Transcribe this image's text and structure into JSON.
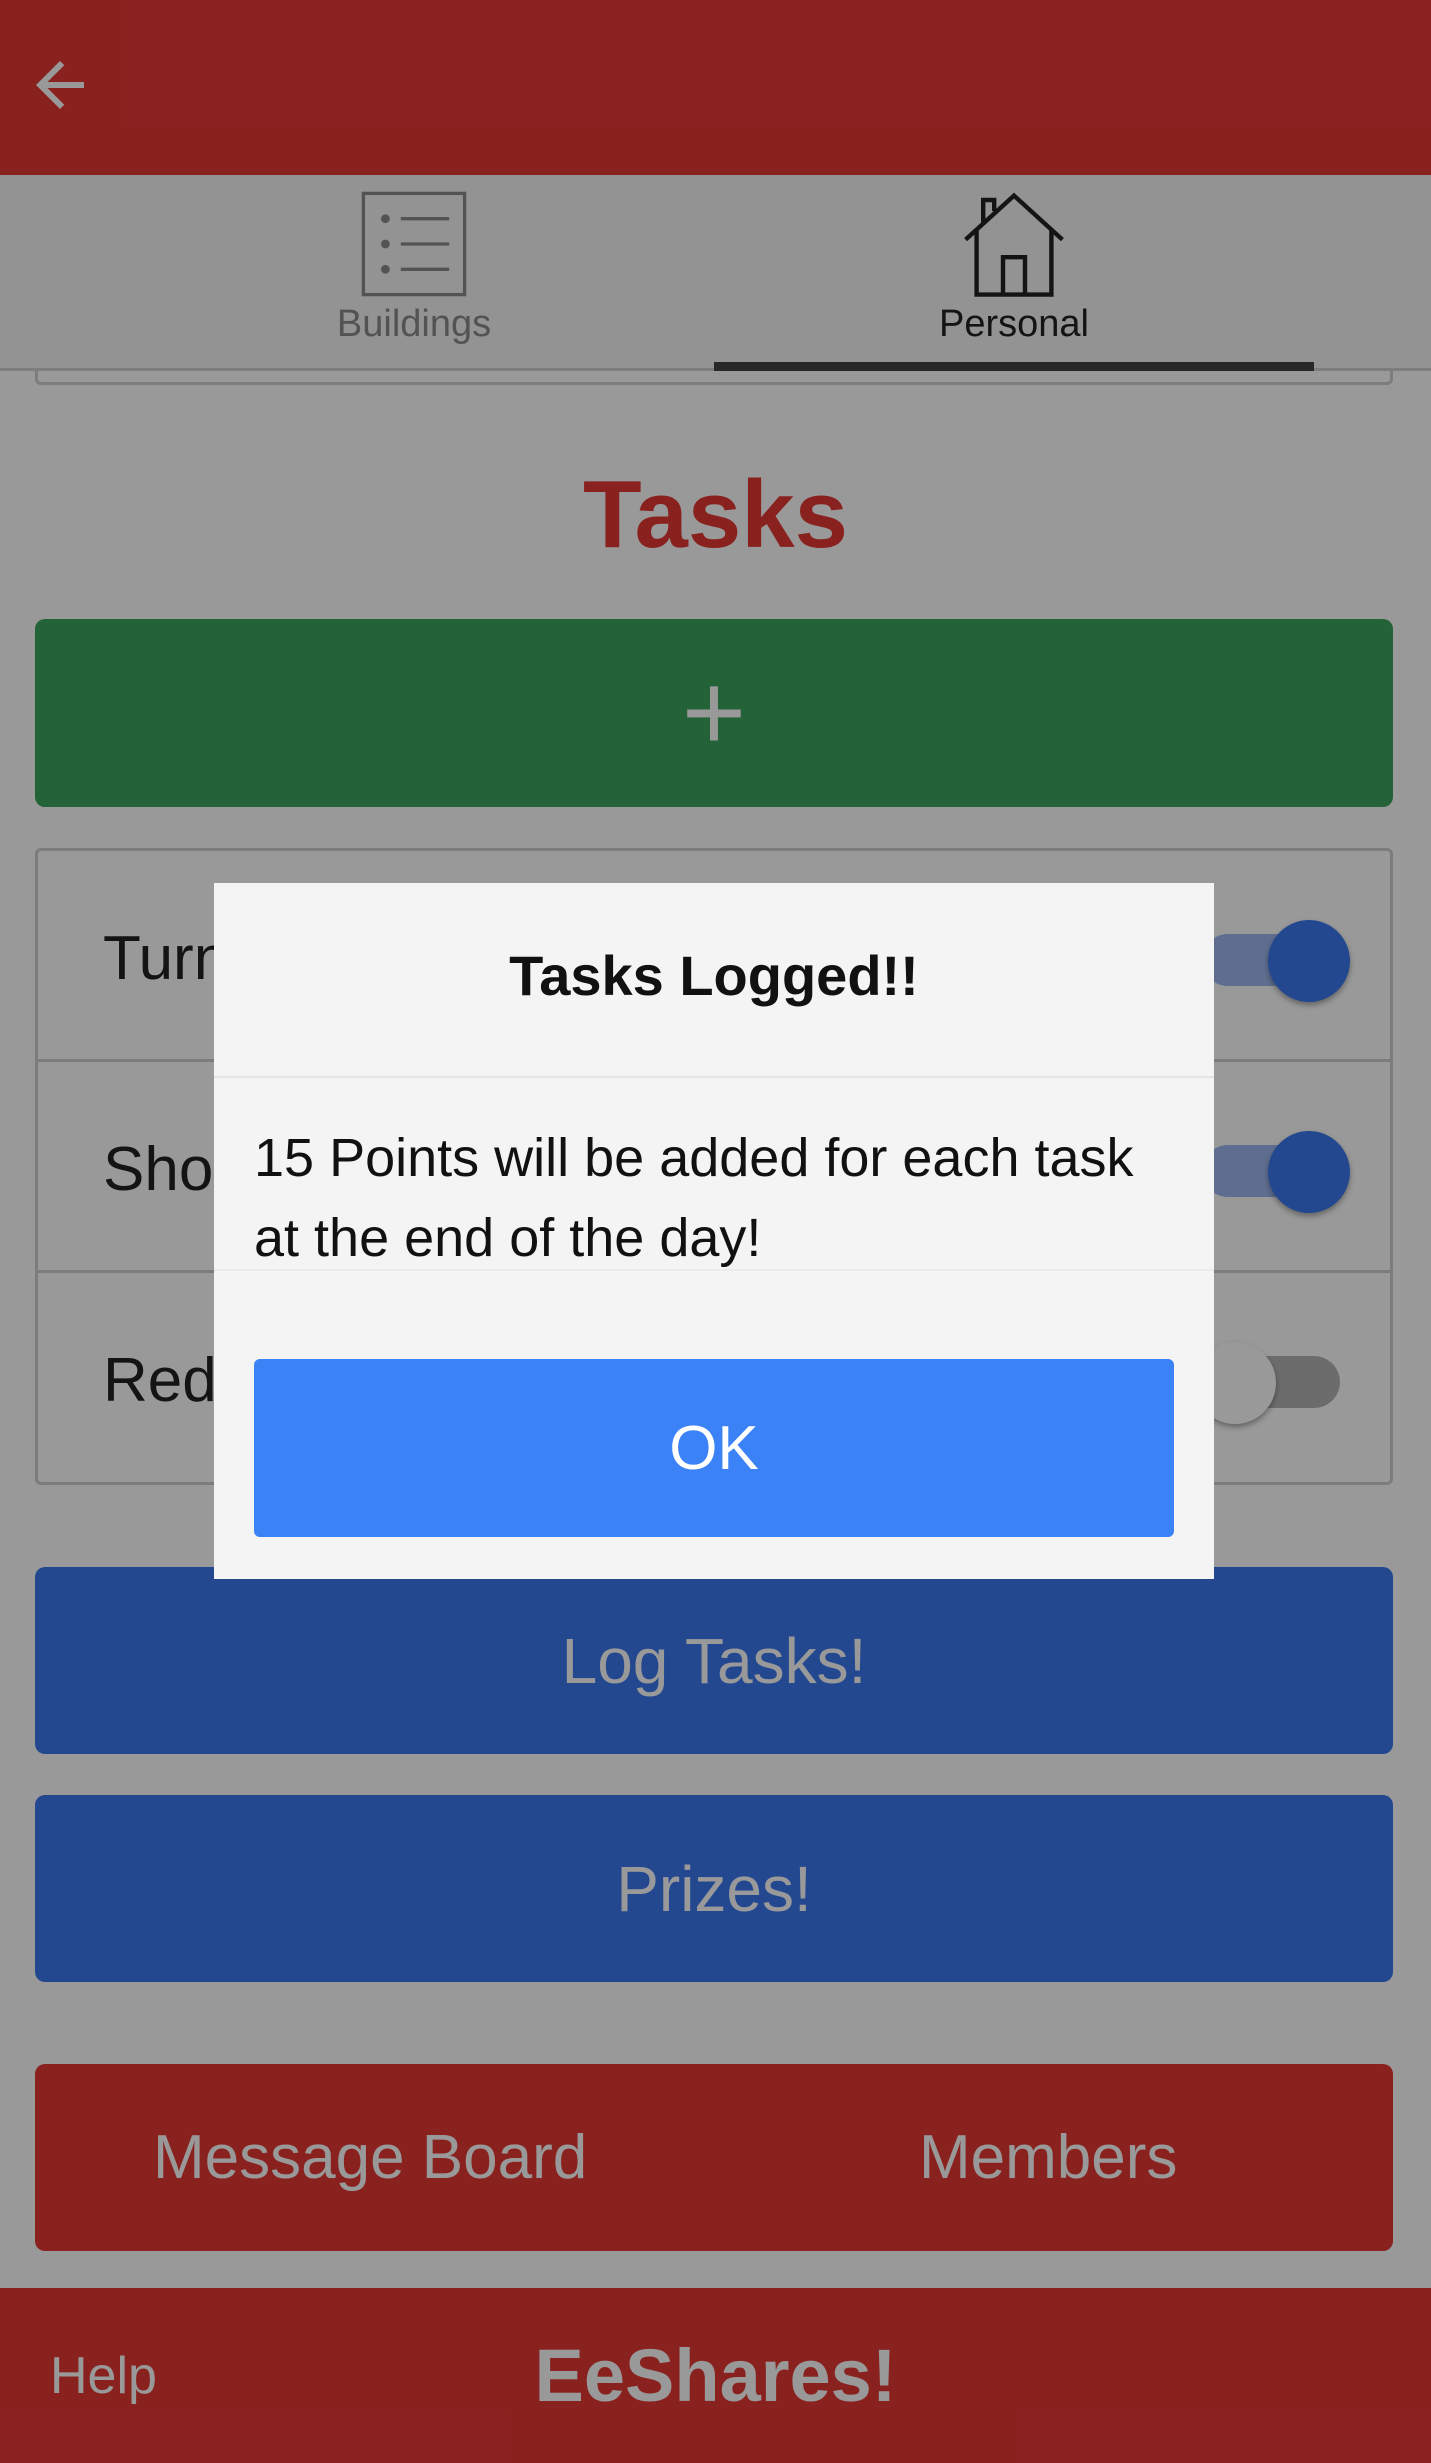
{
  "header": {
    "back_icon": "arrow-left-icon"
  },
  "tabs": [
    {
      "label": "Buildings",
      "icon": "list-icon",
      "active": false
    },
    {
      "label": "Personal",
      "icon": "house-icon",
      "active": true
    }
  ],
  "main": {
    "title": "Tasks",
    "add_label": "+",
    "tasks": [
      {
        "label": "Turn off AC",
        "enabled": true
      },
      {
        "label": "Shorter Showers",
        "enabled": true
      },
      {
        "label": "Reduce electricity",
        "enabled": false
      }
    ],
    "log_button": "Log Tasks!",
    "prizes_button": "Prizes!",
    "message_board": "Message Board",
    "members": "Members"
  },
  "footer": {
    "help": "Help",
    "brand": "EeShares!"
  },
  "dialog": {
    "title": "Tasks Logged!!",
    "message": "15 Points will be added for each task at the end of the day!",
    "ok_label": "OK"
  },
  "colors": {
    "primary_red": "#e53935",
    "primary_blue": "#3b78f0",
    "add_green": "#3ba55d",
    "ok_blue": "#3b82f6"
  }
}
